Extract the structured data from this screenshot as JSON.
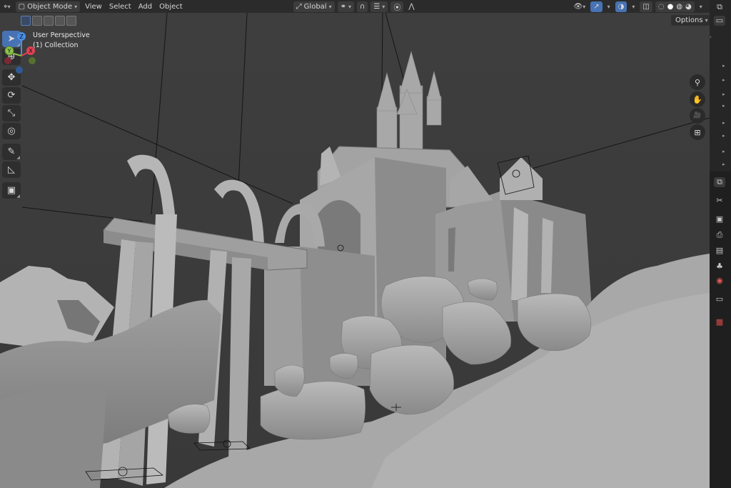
{
  "header": {
    "editor_type_icon": "viewport-editor-icon",
    "mode_label": "Object Mode",
    "menus": [
      "View",
      "Select",
      "Add",
      "Object"
    ],
    "transform_orientation": "Global"
  },
  "viewport": {
    "perspective_label": "User Perspective",
    "collection_label": "(1) Collection",
    "options_label": "Options",
    "gizmo": {
      "z": "Z",
      "y": "Y",
      "x": "X"
    }
  },
  "tools": [
    {
      "name": "select-box",
      "icon": "cursor-icon",
      "glyph": "➤",
      "active": true
    },
    {
      "name": "cursor",
      "icon": "3d-cursor-icon",
      "glyph": "⊕",
      "active": false
    },
    {
      "name": "move",
      "icon": "move-icon",
      "glyph": "✥",
      "active": false
    },
    {
      "name": "rotate",
      "icon": "rotate-icon",
      "glyph": "⟳",
      "active": false
    },
    {
      "name": "scale",
      "icon": "scale-icon",
      "glyph": "⤡",
      "active": false
    },
    {
      "name": "transform",
      "icon": "transform-icon",
      "glyph": "◎",
      "active": false
    },
    {
      "name": "annotate",
      "icon": "annotate-icon",
      "glyph": "✎",
      "active": false
    },
    {
      "name": "measure",
      "icon": "measure-icon",
      "glyph": "◺",
      "active": false
    },
    {
      "name": "add-cube",
      "icon": "add-cube-icon",
      "glyph": "▣",
      "active": false
    }
  ],
  "nav_buttons": [
    {
      "name": "zoom",
      "icon": "zoom-icon",
      "glyph": "⚲"
    },
    {
      "name": "pan",
      "icon": "hand-icon",
      "glyph": "✋"
    },
    {
      "name": "camera",
      "icon": "camera-icon",
      "glyph": "🎥"
    },
    {
      "name": "ortho",
      "icon": "grid-icon",
      "glyph": "⊞"
    }
  ],
  "colors": {
    "accent": "#4772b3",
    "axis_x": "#e04356",
    "axis_y": "#8bc34a",
    "axis_z": "#4a8ee6",
    "header_bg": "#2b2b2b",
    "viewport_bg": "#3d3d3d"
  }
}
